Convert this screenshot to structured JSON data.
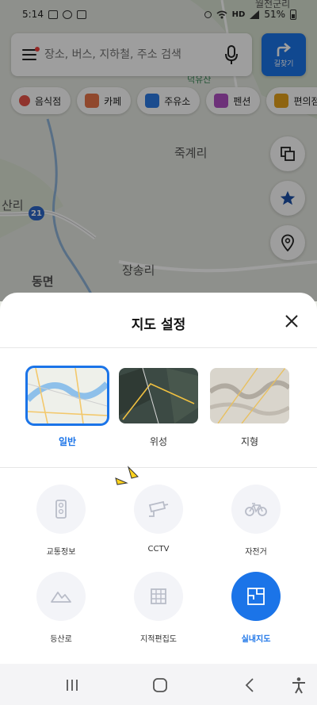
{
  "status_bar": {
    "time": "5:14",
    "network": "HD",
    "battery": "51%"
  },
  "search": {
    "placeholder": "장소, 버스, 지하철, 주소 검색"
  },
  "route_button": {
    "label": "길찾기"
  },
  "categories": [
    {
      "label": "음식점",
      "color": "#e8554a"
    },
    {
      "label": "카페",
      "color": "#e8754a"
    },
    {
      "label": "주유소",
      "color": "#2c7be5"
    },
    {
      "label": "펜션",
      "color": "#b04fc4"
    },
    {
      "label": "편의점",
      "color": "#e6a21b"
    }
  ],
  "map_labels": {
    "mountain": "덕유산",
    "village1": "죽계리",
    "village2": "산리",
    "route": "21",
    "village3": "장송리",
    "village4": "동면",
    "top_right": "월전군리"
  },
  "sheet": {
    "title": "지도 설정",
    "map_types": [
      {
        "label": "일반",
        "selected": true
      },
      {
        "label": "위성",
        "selected": false
      },
      {
        "label": "지형",
        "selected": false
      }
    ],
    "options": [
      {
        "label": "교통정보",
        "icon": "traffic-light-icon",
        "active": false
      },
      {
        "label": "CCTV",
        "icon": "cctv-icon",
        "active": false
      },
      {
        "label": "자전거",
        "icon": "bicycle-icon",
        "active": false
      },
      {
        "label": "등산로",
        "icon": "mountain-icon",
        "active": false
      },
      {
        "label": "지적편집도",
        "icon": "grid-icon",
        "active": false
      },
      {
        "label": "실내지도",
        "icon": "floorplan-icon",
        "active": true
      }
    ]
  },
  "colors": {
    "accent": "#1b74e8"
  }
}
